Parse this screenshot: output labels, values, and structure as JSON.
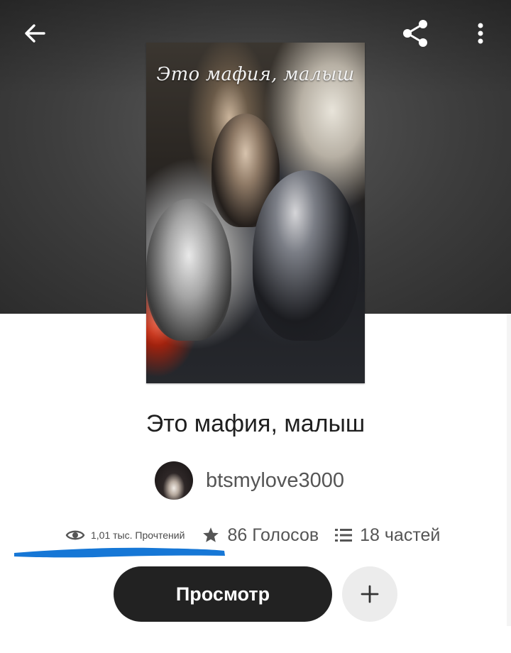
{
  "header": {
    "back_icon": "arrow-left-icon",
    "share_icon": "share-icon",
    "more_icon": "more-vertical-icon"
  },
  "cover": {
    "title_text": "Это мафия, малыш"
  },
  "story": {
    "title": "Это мафия, малыш",
    "author": "btsmylove3000"
  },
  "stats": {
    "reads": "1,01 тыс. Прочтений",
    "votes": "86 Голосов",
    "parts": "18 частей",
    "reads_icon": "eye-icon",
    "votes_icon": "star-icon",
    "parts_icon": "list-icon"
  },
  "actions": {
    "read_label": "Просмотр",
    "add_icon": "plus-icon"
  },
  "colors": {
    "primary_button": "#222222",
    "highlight_stroke": "#1677d6",
    "secondary_button": "#ececec"
  }
}
